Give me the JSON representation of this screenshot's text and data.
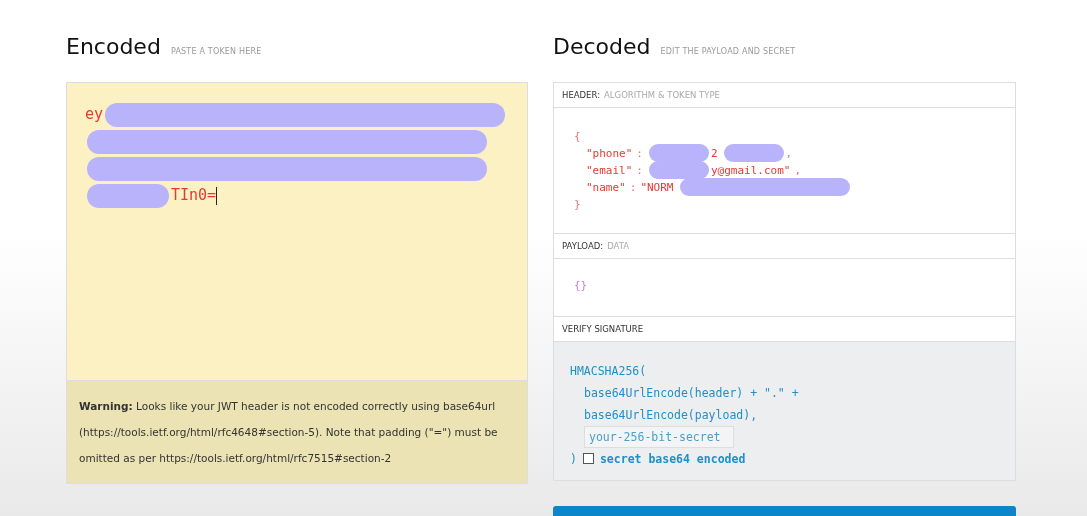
{
  "encoded": {
    "title": "Encoded",
    "subtitle": "PASTE A TOKEN HERE",
    "token_lines": [
      [
        {
          "kind": "text",
          "text": "ey"
        },
        {
          "kind": "redaction"
        }
      ],
      [
        {
          "kind": "redaction"
        }
      ],
      [
        {
          "kind": "redaction"
        }
      ],
      [
        {
          "kind": "redaction"
        },
        {
          "kind": "text",
          "text": "TIn0="
        },
        {
          "kind": "cursor"
        }
      ]
    ],
    "warning": {
      "label": "Warning:",
      "text": "Looks like your JWT header is not encoded correctly using base64url (https://tools.ietf.org/html/rfc4648#section-5). Note that padding (\"=\") must be omitted as per https://tools.ietf.org/html/rfc7515#section-2"
    }
  },
  "decoded": {
    "title": "Decoded",
    "subtitle": "EDIT THE PAYLOAD AND SECRET",
    "header": {
      "label": "HEADER:",
      "hint": "ALGORITHM & TOKEN TYPE",
      "lines": [
        [
          {
            "kind": "punct",
            "text": "{"
          }
        ],
        [
          {
            "kind": "key",
            "text": "\"phone\""
          },
          {
            "kind": "punct",
            "text": ":"
          },
          {
            "kind": "redaction"
          },
          {
            "kind": "value",
            "text": "2"
          },
          {
            "kind": "redaction"
          },
          {
            "kind": "punct",
            "text": ","
          }
        ],
        [
          {
            "kind": "key",
            "text": "\"email\""
          },
          {
            "kind": "punct",
            "text": ":"
          },
          {
            "kind": "redaction"
          },
          {
            "kind": "value",
            "text": "y@gmail.com\""
          },
          {
            "kind": "punct",
            "text": ","
          }
        ],
        [
          {
            "kind": "key",
            "text": "\"name\""
          },
          {
            "kind": "punct",
            "text": ":"
          },
          {
            "kind": "value",
            "text": "\"NORM"
          },
          {
            "kind": "redaction"
          }
        ],
        [
          {
            "kind": "punct",
            "text": "}"
          }
        ]
      ]
    },
    "payload": {
      "label": "PAYLOAD:",
      "hint": "DATA",
      "body": "{}"
    },
    "signature": {
      "label": "VERIFY SIGNATURE",
      "open": "HMACSHA256(",
      "line1": "base64UrlEncode(header) + \".\" +",
      "line2": "base64UrlEncode(payload),",
      "secret_placeholder": "your-256-bit-secret",
      "close": ")",
      "base64_checked": false,
      "base64_label": "secret base64 encoded"
    }
  }
}
